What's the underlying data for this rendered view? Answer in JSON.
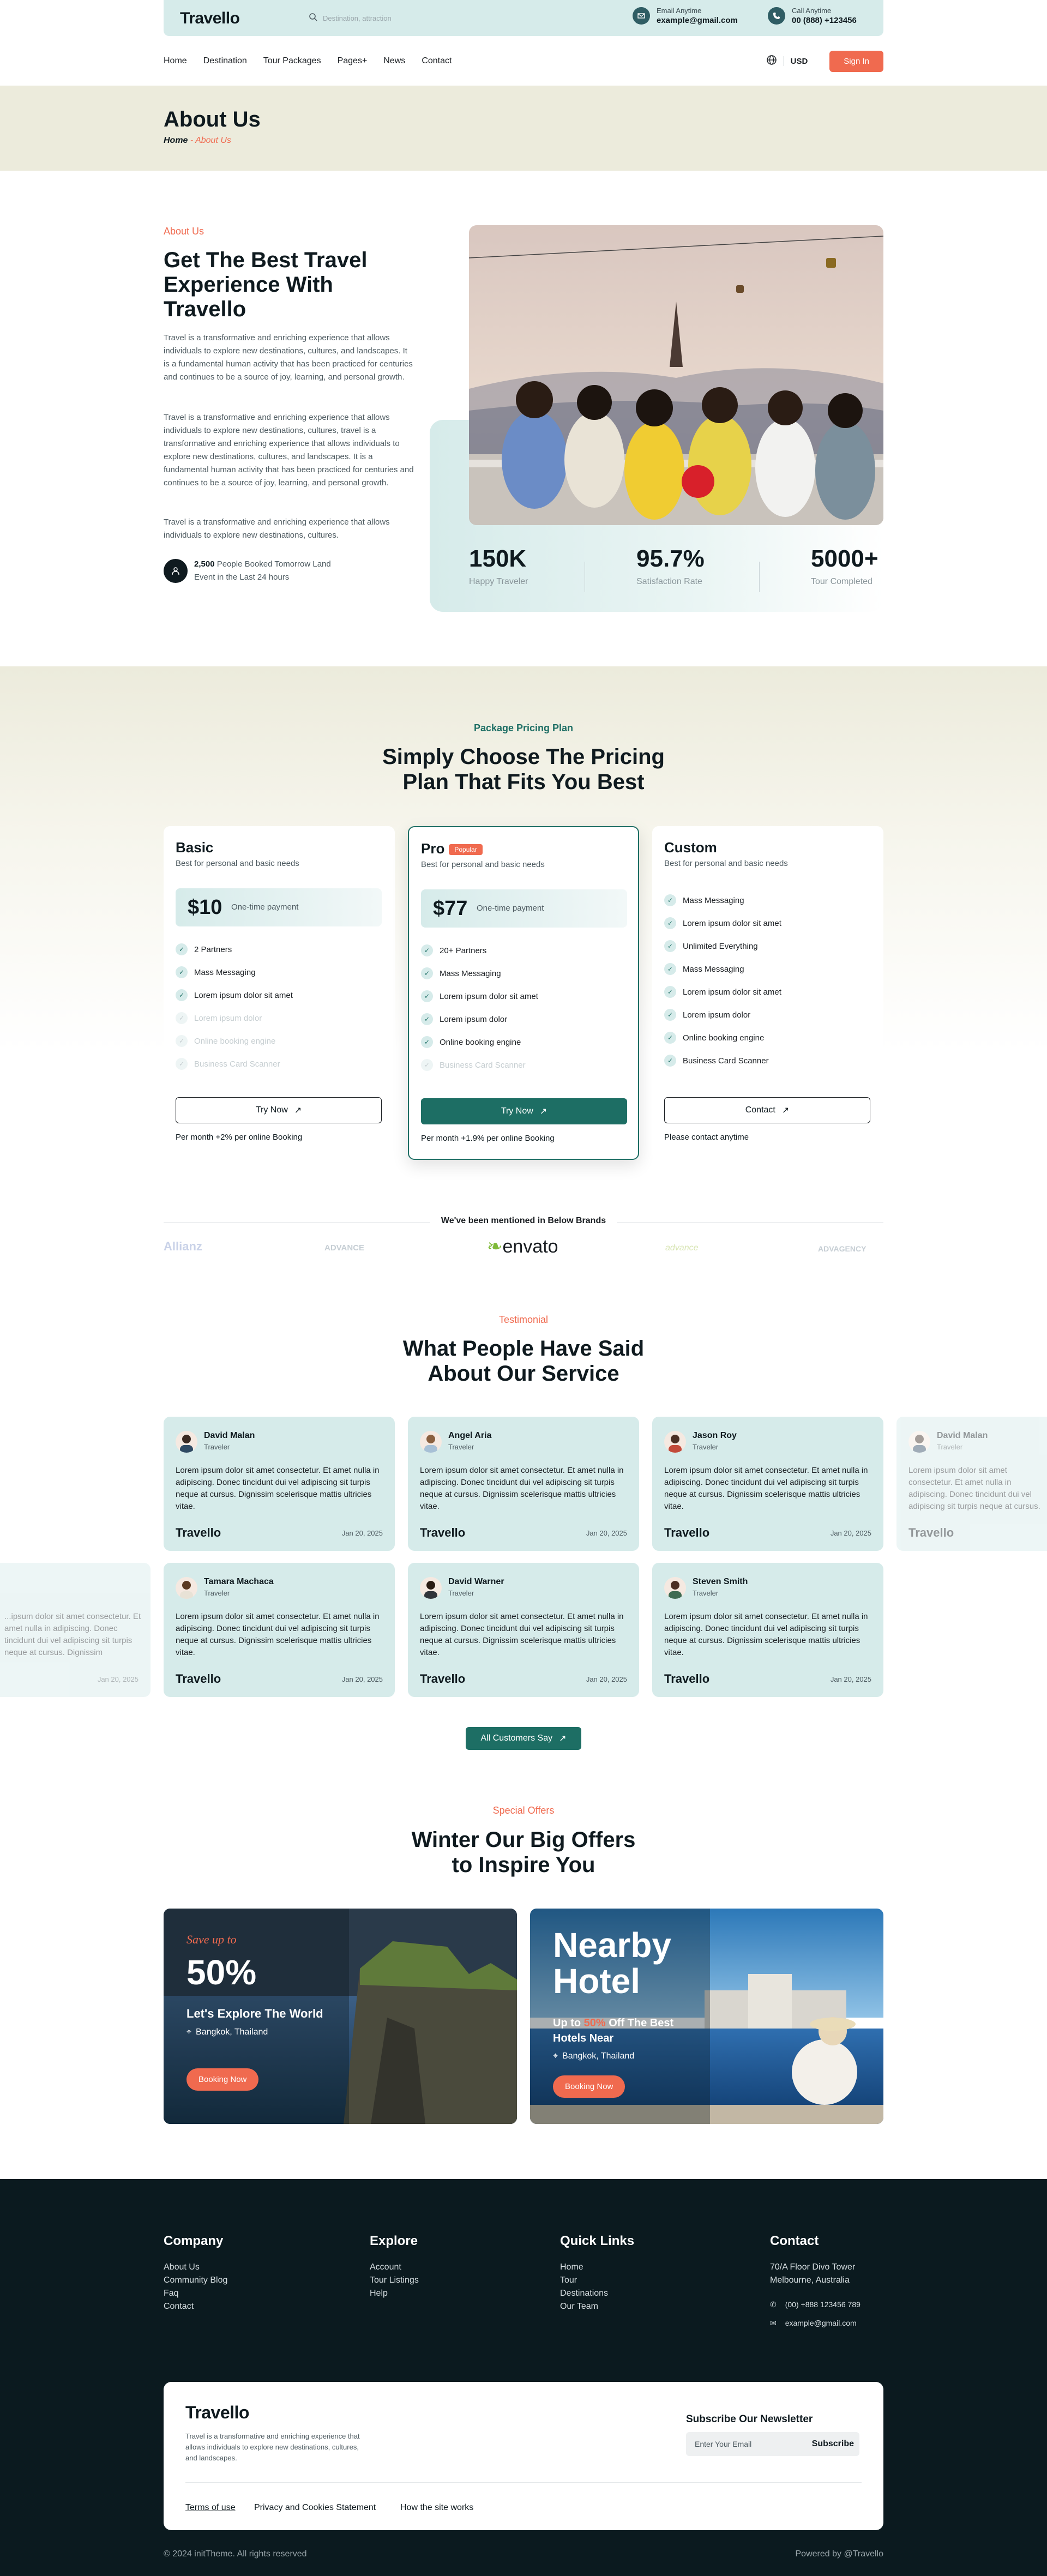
{
  "brand": {
    "name": "Travello"
  },
  "topbar": {
    "search_placeholder": "Destination, attraction",
    "email_label": "Email Anytime",
    "email_value": "example@gmail.com",
    "call_label": "Call Anytime",
    "call_value": "00 (888) +123456"
  },
  "nav": {
    "items": [
      "Home",
      "Destination",
      "Tour Packages",
      "Pages+",
      "News",
      "Contact"
    ],
    "currency": "USD",
    "signin": "Sign In"
  },
  "hero": {
    "title": "About Us",
    "crumb_home": "Home",
    "crumb_sep": " - ",
    "crumb_current": "About Us"
  },
  "about": {
    "eyebrow": "About Us",
    "title": "Get The Best Travel Experience With Travello",
    "p1": "Travel is a transformative and enriching experience that allows individuals to explore new destinations, cultures, and landscapes. It is a fundamental human activity that has been practiced for centuries and continues to be a source of joy, learning, and personal growth.",
    "p2": "Travel is a transformative and enriching experience that allows individuals to explore new destinations, cultures, travel is a transformative and enriching experience that allows individuals to explore new destinations, cultures, and landscapes. It is a fundamental human activity that has been practiced for centuries and continues to be a source of joy, learning, and personal growth.",
    "p3": "Travel is a transformative and enriching experience that allows individuals to explore new destinations, cultures.",
    "booked_count": "2,500",
    "booked_text": " People Booked Tomorrow Land",
    "booked_text2": "Event in the Last 24 hours",
    "stats": [
      {
        "value": "150K",
        "label": "Happy Traveler"
      },
      {
        "value": "95.7%",
        "label": "Satisfaction Rate"
      },
      {
        "value": "5000+",
        "label": "Tour Completed"
      }
    ]
  },
  "pricing": {
    "eyebrow": "Package Pricing Plan",
    "title_line1": "Simply Choose The Pricing",
    "title_line2": "Plan That Fits You Best",
    "plans": [
      {
        "name": "Basic",
        "sub": "Best for personal and basic needs",
        "price": "$10",
        "period": "One-time payment",
        "features": [
          "2 Partners",
          "Mass Messaging",
          "Lorem ipsum dolor sit amet",
          "Lorem ipsum dolor",
          "Online booking engine",
          "Business Card Scanner"
        ],
        "button": "Try Now",
        "footer": "Per month +2% per online Booking"
      },
      {
        "name": "Pro",
        "badge": "Popular",
        "sub": "Best for personal and basic needs",
        "price": "$77",
        "period": "One-time payment",
        "features": [
          "20+ Partners",
          "Mass Messaging",
          "Lorem ipsum dolor sit amet",
          "Lorem ipsum dolor",
          "Online booking engine",
          "Business Card Scanner"
        ],
        "button": "Try Now",
        "footer": "Per month +1.9% per online Booking"
      },
      {
        "name": "Custom",
        "sub": "Best for personal and basic needs",
        "features": [
          "Mass Messaging",
          "Lorem ipsum dolor sit amet",
          "Unlimited Everything",
          "Mass Messaging",
          "Lorem ipsum dolor sit amet",
          "Lorem ipsum dolor",
          "Online booking engine",
          "Business Card Scanner"
        ],
        "button": "Contact",
        "footer": "Please contact anytime"
      }
    ]
  },
  "brands": {
    "title": "We've been mentioned in Below Brands",
    "items": [
      "Allianz",
      "ADVANCE",
      "envato",
      "advance",
      "ADVAGENCY"
    ]
  },
  "testimonials": {
    "eyebrow": "Testimonial",
    "title_line1": "What People Have Said",
    "title_line2": "About Our Service",
    "text": "Lorem ipsum dolor sit amet consectetur. Et amet nulla in adipiscing. Donec tincidunt dui vel adipiscing sit turpis neque at cursus. Dignissim scelerisque mattis ultricies vitae.",
    "partial_text": "...ipsum dolor sit amet consectetur. Et amet nulla in adipiscing. Donec tincidunt dui vel adipiscing sit turpis neque at cursus. Dignissim scelerisque mattis ultricies vitae.",
    "date": "Jan 20, 2025",
    "role": "Traveler",
    "names": [
      "David Malan",
      "Angel Aria",
      "Jason Roy",
      "David Malan",
      "Tamara Machaca",
      "David Warner",
      "Steven Smith"
    ],
    "button": "All Customers Say"
  },
  "offers": {
    "eyebrow": "Special Offers",
    "title_line1": "Winter Our Big Offers",
    "title_line2": "to Inspire You",
    "card1": {
      "kicker": "Save up to",
      "big": "50%",
      "headline": "Let's Explore The World",
      "location": "Bangkok, Thailand",
      "button": "Booking Now"
    },
    "card2": {
      "big1": "Nearby",
      "big2": "Hotel",
      "line_pre": "Up to ",
      "line_pct": "50%",
      "line_post": " Off The Best",
      "line2": "Hotels Near",
      "location": "Bangkok, Thailand",
      "button": "Booking Now"
    }
  },
  "footer": {
    "company": {
      "title": "Company",
      "links": [
        "About Us",
        "Community Blog",
        "Faq",
        "Contact"
      ]
    },
    "explore": {
      "title": "Explore",
      "links": [
        "Account",
        "Tour Listings",
        "Help"
      ]
    },
    "quick": {
      "title": "Quick Links",
      "links": [
        "Home",
        "Tour",
        "Destinations",
        "Our Team"
      ]
    },
    "contact": {
      "title": "Contact",
      "address1": "70/A Floor Divo Tower",
      "address2": "Melbourne, Australia",
      "phone": "(00) +888 123456 789",
      "email": "example@gmail.com"
    },
    "about_text": "Travel is a transformative and enriching experience that allows individuals to explore new destinations, cultures, and landscapes.",
    "newsletter_title": "Subscribe Our Newsletter",
    "newsletter_placeholder": "Enter Your Email",
    "subscribe": "Subscribe",
    "legal": [
      "Terms of use",
      "Privacy and Cookies Statement",
      "How the site works"
    ],
    "copyright": "© 2024 initTheme. All rights reserved",
    "powered": "Powered by @Travello"
  },
  "colors": {
    "accent": "#f06a4f",
    "teal": "#1d6e64",
    "mint": "#d6ebea",
    "dark": "#0b1a1f",
    "cream": "#ecebdc"
  }
}
